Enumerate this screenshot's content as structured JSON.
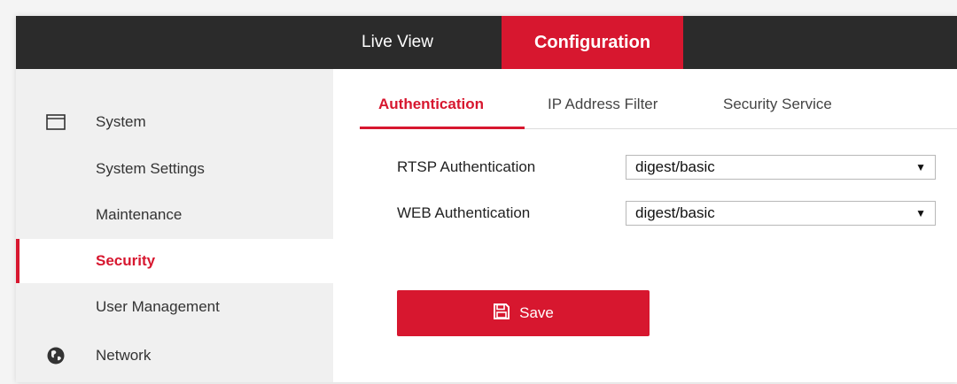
{
  "topnav": {
    "live_view": "Live View",
    "configuration": "Configuration"
  },
  "sidebar": {
    "system": {
      "label": "System",
      "icon": "monitor-window-icon"
    },
    "items": [
      {
        "label": "System Settings"
      },
      {
        "label": "Maintenance"
      },
      {
        "label": "Security",
        "selected": true
      },
      {
        "label": "User Management"
      }
    ],
    "network": {
      "label": "Network",
      "icon": "globe-icon"
    }
  },
  "tabs": [
    {
      "label": "Authentication",
      "active": true
    },
    {
      "label": "IP Address Filter"
    },
    {
      "label": "Security Service"
    }
  ],
  "form": {
    "rtsp": {
      "label": "RTSP Authentication",
      "value": "digest/basic"
    },
    "web": {
      "label": "WEB Authentication",
      "value": "digest/basic"
    }
  },
  "save": {
    "label": "Save",
    "icon": "floppy-disk-icon"
  },
  "colors": {
    "accent": "#d7172f",
    "topbar": "#2b2b2b",
    "sidebar": "#f0f0f0"
  }
}
